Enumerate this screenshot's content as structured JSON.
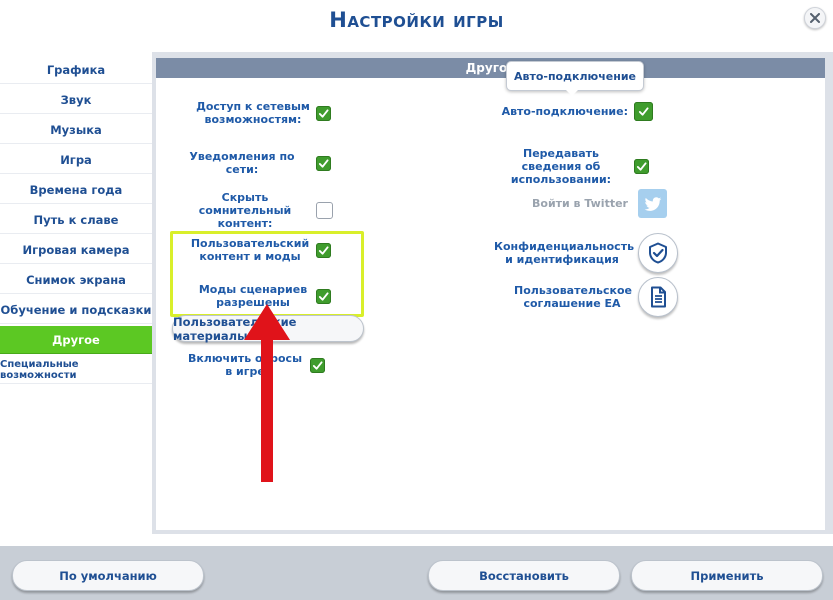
{
  "window": {
    "title": "Настройки игры"
  },
  "sidebar": {
    "items": [
      {
        "label": "Графика"
      },
      {
        "label": "Звук"
      },
      {
        "label": "Музыка"
      },
      {
        "label": "Игра"
      },
      {
        "label": "Времена года"
      },
      {
        "label": "Путь к славе"
      },
      {
        "label": "Игровая камера"
      },
      {
        "label": "Снимок экрана"
      },
      {
        "label": "Обучение и подсказки"
      },
      {
        "label": "Другое",
        "active": true
      },
      {
        "label": "Специальные возможности"
      }
    ]
  },
  "panel": {
    "header": "Другое"
  },
  "tooltip": {
    "text": "Авто-подключение"
  },
  "left_options": [
    {
      "label": "Доступ к сетевым возможностям:",
      "checked": true
    },
    {
      "label": "Уведомления по сети:",
      "checked": true
    },
    {
      "label": "Скрыть сомнительный контент:",
      "checked": false
    },
    {
      "label": "Пользовательский контент и моды",
      "checked": true
    },
    {
      "label": "Моды сценариев разрешены",
      "checked": true
    },
    {
      "label": "Включить опросы в игре",
      "checked": true
    }
  ],
  "custom_content_button": {
    "label": "Пользовательские материалы"
  },
  "right_options": [
    {
      "label": "Авто-подключение:",
      "checked": true
    },
    {
      "label": "Передавать сведения об использовании:",
      "checked": true
    }
  ],
  "twitter": {
    "label": "Войти в Twitter",
    "icon": "twitter-bird-icon"
  },
  "privacy": {
    "label": "Конфиденциальность и идентификация",
    "icon": "shield-check-icon"
  },
  "user_agreement": {
    "label": "Пользовательское соглашение EA",
    "icon": "document-icon"
  },
  "footer": {
    "default_label": "По умолчанию",
    "restore_label": "Восстановить",
    "apply_label": "Применить"
  },
  "colors": {
    "accent_blue": "#1f4f93",
    "active_green": "#5cc823",
    "checkbox_green": "#3f9c2d",
    "highlight_yellow": "#d9ef2a",
    "arrow_red": "#e0131a",
    "header_gray": "#7b8ca6"
  }
}
